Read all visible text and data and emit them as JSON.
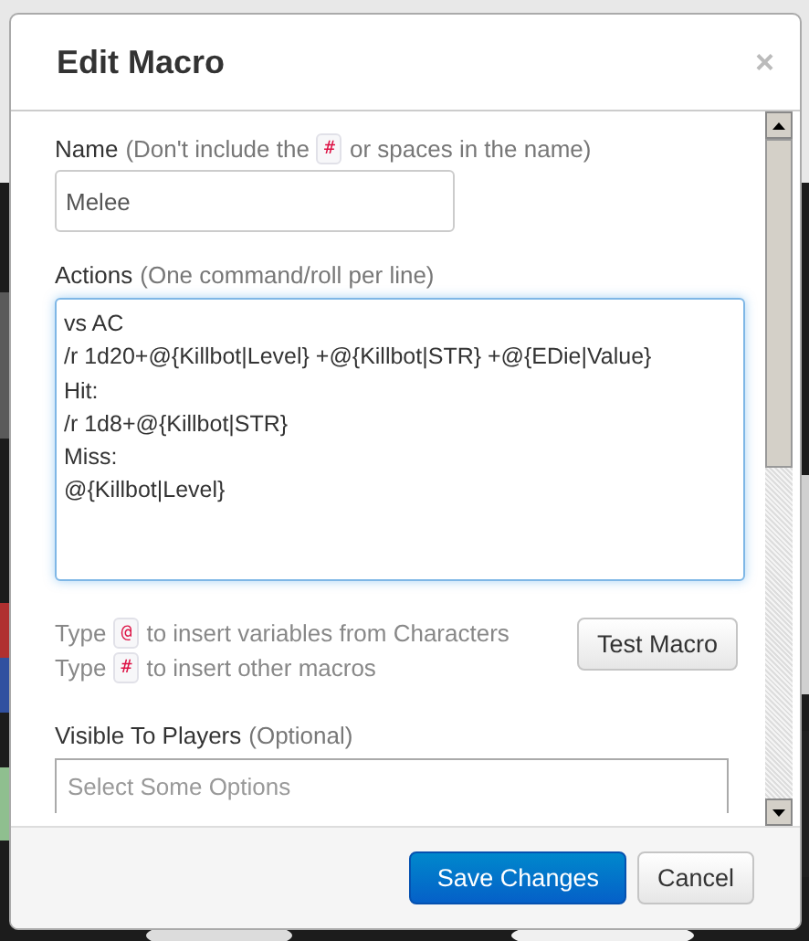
{
  "dialog": {
    "title": "Edit Macro",
    "close": "×"
  },
  "name_field": {
    "label": "Name",
    "hint_before": "(Don't include the",
    "hint_code": "#",
    "hint_after": "or spaces in the name)",
    "value": "Melee"
  },
  "actions_field": {
    "label": "Actions",
    "hint": "(One command/roll per line)",
    "lines": [
      "vs AC",
      "/r 1d20+@{Killbot|Level} +@{Killbot|STR} +@{EDie|Value}",
      "Hit:",
      "/r 1d8+@{Killbot|STR}",
      "Miss:",
      "@{Killbot|Level} "
    ]
  },
  "tips": [
    {
      "before": "Type",
      "code": "@",
      "after": "to insert variables from Characters"
    },
    {
      "before": "Type",
      "code": "#",
      "after": "to insert other macros"
    }
  ],
  "test_button": "Test Macro",
  "visible_field": {
    "label": "Visible To Players",
    "hint": "(Optional)",
    "placeholder": "Select Some Options"
  },
  "buttons": [
    {
      "label": "Save Changes",
      "kind": "primary"
    },
    {
      "label": "Cancel",
      "kind": "default"
    }
  ]
}
